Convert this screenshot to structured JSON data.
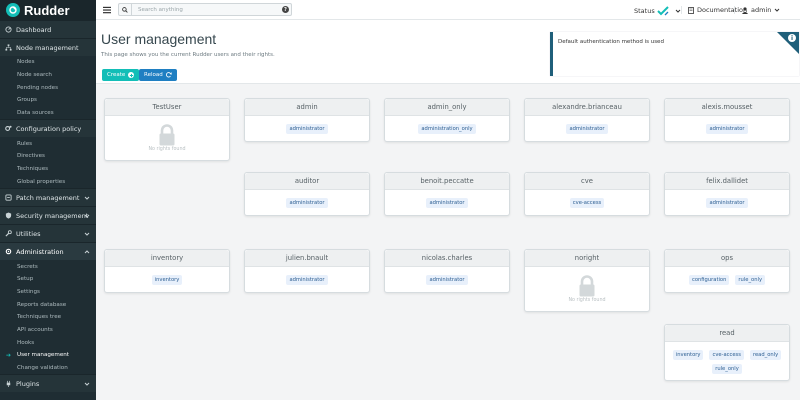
{
  "app": {
    "brand": "Rudder"
  },
  "sidebar": {
    "items": [
      {
        "type": "section",
        "label": "Dashboard",
        "icon": "dashboard-icon",
        "chevron": false,
        "active": false
      },
      {
        "type": "section",
        "label": "Node management",
        "icon": "sitemap-icon",
        "chevron": false,
        "active": false
      },
      {
        "type": "sub",
        "label": "Nodes"
      },
      {
        "type": "sub",
        "label": "Node search"
      },
      {
        "type": "sub",
        "label": "Pending nodes"
      },
      {
        "type": "sub",
        "label": "Groups"
      },
      {
        "type": "sub",
        "label": "Data sources"
      },
      {
        "type": "section",
        "label": "Configuration policy",
        "icon": "gears-icon",
        "chevron": false,
        "active": false
      },
      {
        "type": "sub",
        "label": "Rules"
      },
      {
        "type": "sub",
        "label": "Directives"
      },
      {
        "type": "sub",
        "label": "Techniques"
      },
      {
        "type": "sub",
        "label": "Global properties"
      },
      {
        "type": "section",
        "label": "Patch management",
        "icon": "patch-icon",
        "chevron": true,
        "active": false
      },
      {
        "type": "section",
        "label": "Security management",
        "icon": "shield-icon",
        "chevron": true,
        "active": false
      },
      {
        "type": "section",
        "label": "Utilities",
        "icon": "wrench-icon",
        "chevron": true,
        "active": false
      },
      {
        "type": "section",
        "label": "Administration",
        "icon": "gear-icon",
        "chevron": true,
        "active": true
      },
      {
        "type": "sub",
        "label": "Secrets"
      },
      {
        "type": "sub",
        "label": "Setup"
      },
      {
        "type": "sub",
        "label": "Settings"
      },
      {
        "type": "sub",
        "label": "Reports database"
      },
      {
        "type": "sub",
        "label": "Techniques tree"
      },
      {
        "type": "sub",
        "label": "API accounts"
      },
      {
        "type": "sub",
        "label": "Hooks"
      },
      {
        "type": "sub",
        "label": "User management",
        "active": true
      },
      {
        "type": "sub",
        "label": "Change validation"
      },
      {
        "type": "section",
        "label": "Plugins",
        "icon": "plug-icon",
        "chevron": true,
        "active": false
      }
    ]
  },
  "topbar": {
    "search_placeholder": "Search anything",
    "help_label": "?",
    "status_label": "Status",
    "documentation_label": "Documentation",
    "user_label": "admin"
  },
  "page": {
    "title": "User management",
    "description": "This page shows you the current Rudder users and their rights.",
    "create_label": "Create",
    "reload_label": "Reload",
    "info_text": "Default authentication method is used",
    "info_icon_label": "i",
    "no_rights_label": "No rights found"
  },
  "users": [
    {
      "name": "TestUser",
      "roles": []
    },
    {
      "name": "admin",
      "roles": [
        "administrator"
      ]
    },
    {
      "name": "admin_only",
      "roles": [
        "administration_only"
      ]
    },
    {
      "name": "alexandre.brianceau",
      "roles": [
        "administrator"
      ]
    },
    {
      "name": "alexis.mousset",
      "roles": [
        "administrator"
      ]
    },
    {
      "name": "auditor",
      "roles": [
        "administrator"
      ]
    },
    {
      "name": "benoit.peccatte",
      "roles": [
        "administrator"
      ]
    },
    {
      "name": "cve",
      "roles": [
        "cve-access"
      ]
    },
    {
      "name": "felix.dallidet",
      "roles": [
        "administrator"
      ]
    },
    {
      "name": "inventory",
      "roles": [
        "inventory"
      ]
    },
    {
      "name": "julien.bnault",
      "roles": [
        "administrator"
      ]
    },
    {
      "name": "nicolas.charles",
      "roles": [
        "administrator"
      ]
    },
    {
      "name": "noright",
      "roles": []
    },
    {
      "name": "ops",
      "roles": [
        "configuration",
        "rule_only"
      ]
    },
    {
      "name": "read",
      "roles": [
        "inventory",
        "cve-access",
        "read_only",
        "rule_only"
      ]
    }
  ],
  "colors": {
    "accent": "#13beb7",
    "reload": "#1f7fc2",
    "sidebar": "#1f2d33",
    "chip_bg": "#e8f0fb",
    "chip_text": "#2b5d91"
  }
}
